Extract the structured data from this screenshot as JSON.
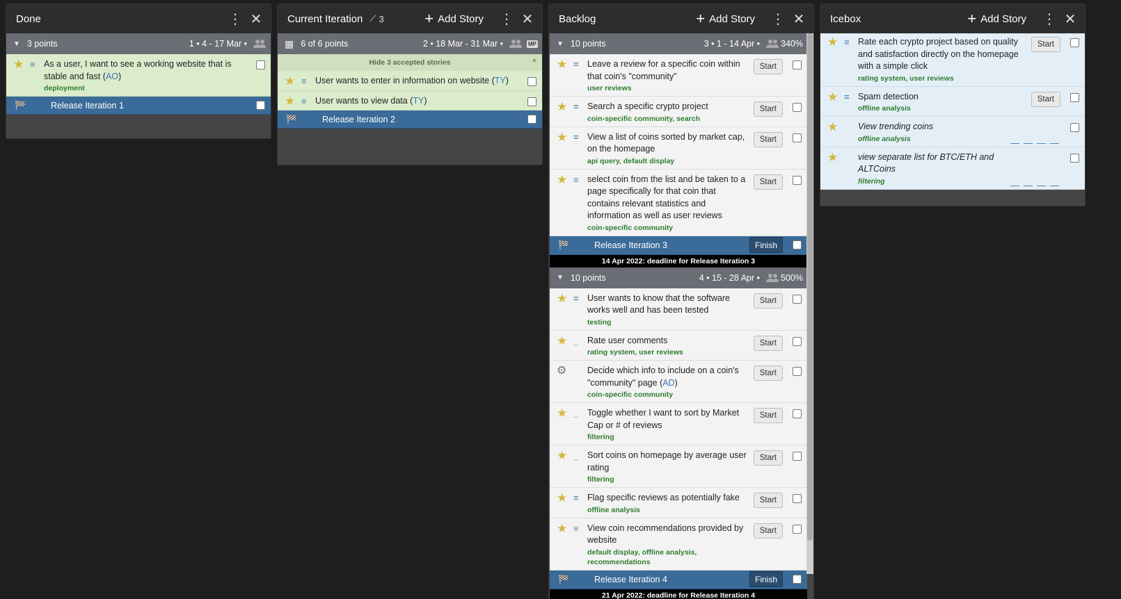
{
  "done": {
    "title": "Done",
    "iteration": {
      "points": "3 points",
      "meta": "1 • 4 - 17 Mar •"
    },
    "stories": [
      {
        "title": "As a user, I want to see a working website that is stable and fast",
        "owner": "AO",
        "labels": "deployment"
      }
    ],
    "release": {
      "title": "Release Iteration 1"
    }
  },
  "current": {
    "title": "Current Iteration",
    "velocity": "3",
    "add_story": "Add Story",
    "iteration": {
      "points": "6 of 6 points",
      "meta": "2 • 18 Mar - 31 Mar •",
      "badge": "MP"
    },
    "hide_accepted": "Hide 3 accepted stories",
    "stories": [
      {
        "title": "User wants to enter in information on website",
        "owner": "TY"
      },
      {
        "title": "User wants to view data",
        "owner": "TY"
      }
    ],
    "release": {
      "title": "Release Iteration 2"
    }
  },
  "backlog": {
    "title": "Backlog",
    "add_story": "Add Story",
    "start_label": "Start",
    "finish_label": "Finish",
    "iter1": {
      "points": "10 points",
      "meta": "3 • 1 - 14 Apr •",
      "pct": "340%"
    },
    "iter1_stories": [
      {
        "title": "Leave a review for a specific coin within that coin's \"community\"",
        "labels": "user reviews"
      },
      {
        "title": "Search a specific crypto project",
        "labels": "coin-specific community, search"
      },
      {
        "title": "View a list of coins sorted by market cap, on the homepage",
        "labels": "api query, default display"
      },
      {
        "title": "select coin from the list and be taken to a page specifically for that coin that contains relevant statistics and information as well as user reviews",
        "labels": "coin-specific community"
      }
    ],
    "release3": {
      "title": "Release Iteration 3",
      "deadline": "14 Apr 2022: deadline for Release Iteration 3"
    },
    "iter2": {
      "points": "10 points",
      "meta": "4 • 15 - 28 Apr •",
      "pct": "500%"
    },
    "iter2_stories": [
      {
        "title": "User wants to know that the software works well and has been tested",
        "labels": "testing"
      },
      {
        "title": "Rate user comments",
        "labels": "rating system, user reviews"
      },
      {
        "title": "Decide which info to include on a coin's \"community\" page",
        "owner": "AD",
        "labels": "coin-specific community"
      },
      {
        "title": "Toggle whether I want to sort by Market Cap or # of reviews",
        "labels": "filtering"
      },
      {
        "title": "Sort coins on homepage by average user rating",
        "labels": "filtering"
      },
      {
        "title": "Flag specific reviews as potentially fake",
        "labels": "offline analysis"
      },
      {
        "title": "View coin recommendations provided by website",
        "labels": "default display, offline analysis, recommendations"
      }
    ],
    "release4": {
      "title": "Release Iteration 4",
      "deadline": "21 Apr 2022: deadline for Release Iteration 4"
    }
  },
  "icebox": {
    "title": "Icebox",
    "add_story": "Add Story",
    "start_label": "Start",
    "stories": [
      {
        "title": "Rate each crypto project based on quality and satisfaction directly on the homepage with a simple click",
        "labels": "rating system, user reviews"
      },
      {
        "title": "Spam detection",
        "labels": "offline analysis"
      },
      {
        "title": "View trending coins",
        "labels": "offline analysis"
      },
      {
        "title": "view separate list for BTC/ETH and ALTCoins",
        "labels": "filtering"
      }
    ]
  },
  "colors": {
    "accepted": "#dbeccc",
    "release": "#3a6b99",
    "icebox": "#e4eef7",
    "star": "#d3b73d"
  }
}
